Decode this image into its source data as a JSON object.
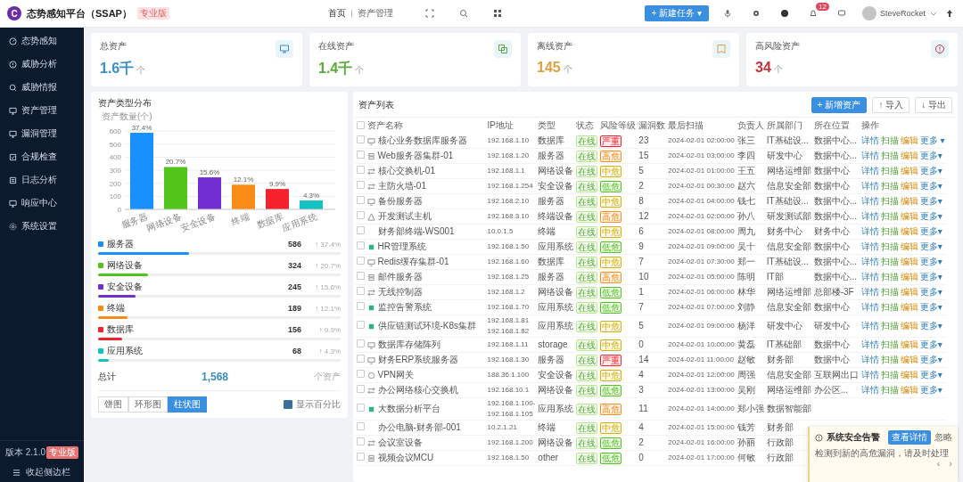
{
  "header": {
    "logo": "C",
    "title": "态势感知平台（SSAP）",
    "edition": "专业版",
    "breadcrumb": [
      "首页",
      "资产管理"
    ],
    "new_task": "+ 新建任务 ▾",
    "notify_count": "12",
    "user": "SteveRocket"
  },
  "sidebar": {
    "items": [
      {
        "label": "态势感知",
        "selected": false
      },
      {
        "label": "威胁分析",
        "selected": false
      },
      {
        "label": "威胁情报",
        "selected": false
      },
      {
        "label": "资产管理",
        "selected": false
      },
      {
        "label": "漏洞管理",
        "selected": false
      },
      {
        "label": "合规检查",
        "selected": false
      },
      {
        "label": "日志分析",
        "selected": false
      },
      {
        "label": "响应中心",
        "selected": false
      },
      {
        "label": "系统设置",
        "selected": false
      }
    ],
    "version": "版本 2.1.0",
    "version_badge": "专业版",
    "collapse": "收起侧边栏"
  },
  "stats": [
    {
      "label": "总资产",
      "value": "1.6千",
      "unit": "个",
      "color": "#3a8fc4"
    },
    {
      "label": "在线资产",
      "value": "1.4千",
      "unit": "个",
      "color": "#5bab3a"
    },
    {
      "label": "离线资产",
      "value": "145",
      "unit": "个",
      "color": "#e0a040"
    },
    {
      "label": "高风险资产",
      "value": "34",
      "unit": "个",
      "color": "#c8323c"
    }
  ],
  "distribution": {
    "title": "资产类型分布",
    "chart_data": {
      "type": "bar",
      "ylabel": "资产数量(个)",
      "categories": [
        "服务器",
        "网络设备",
        "安全设备",
        "终端",
        "数据库",
        "应用系统"
      ],
      "series": [
        {
          "values": [
            586,
            324,
            245,
            189,
            156,
            68
          ]
        }
      ],
      "ylim": [
        0,
        600
      ],
      "yticks": [
        0,
        100,
        200,
        300,
        400,
        500,
        600
      ],
      "grid": true,
      "value_labels": [
        "37.4%",
        "20.7%",
        "15.6%",
        "12.1%",
        "9.9%",
        "4.3%"
      ]
    },
    "items": [
      {
        "name": "服务器",
        "count": "586",
        "share": "↑ 37.4%",
        "level": 0.374,
        "color": "#1890ff"
      },
      {
        "name": "网络设备",
        "count": "324",
        "share": "↑ 20.7%",
        "level": 0.207,
        "color": "#52c41a"
      },
      {
        "name": "安全设备",
        "count": "245",
        "share": "↑ 15.6%",
        "level": 0.156,
        "color": "#722ed1"
      },
      {
        "name": "终端",
        "count": "189",
        "share": "↑ 12.1%",
        "level": 0.121,
        "color": "#fa8c16"
      },
      {
        "name": "数据库",
        "count": "156",
        "share": "↑ 9.9%",
        "level": 0.099,
        "color": "#f5222d"
      },
      {
        "name": "应用系统",
        "count": "68",
        "share": "↑ 4.3%",
        "level": 0.043,
        "color": "#13c2c2"
      }
    ],
    "total_label": "总计",
    "total": "1,568",
    "total_unit": "个资产",
    "views": [
      {
        "label": "饼图",
        "selected": false
      },
      {
        "label": "环形图",
        "selected": false
      },
      {
        "label": "柱状图",
        "selected": true
      }
    ],
    "show_percent": {
      "label": "显示百分比",
      "checked": true
    }
  },
  "assets": {
    "title": "资产列表",
    "actions": [
      "+ 新增资产",
      "↑ 导入",
      "↓ 导出"
    ],
    "select_all": false,
    "columns": [
      "资产名称",
      "IP地址",
      "类型",
      "状态",
      "风险等级",
      "漏洞数",
      "最后扫描",
      "负责人",
      "所属部门",
      "所在位置",
      "操作"
    ],
    "rows": [
      {
        "kind": "monitor",
        "checked": false,
        "name": "核心业务数据库服务器",
        "ip": [
          "192.168.1.10"
        ],
        "type": "数据库",
        "status": "在线",
        "risk": "严重",
        "color": "#f5222d",
        "vulns": "23",
        "scan": "2024-02-01 02:00:00",
        "owner": "张三",
        "dept": "IT基础设...",
        "location": "数据中心...",
        "ops": [
          "详情",
          "扫描",
          "编辑",
          "更多 ▾"
        ]
      },
      {
        "kind": "node",
        "checked": false,
        "name": "Web服务器集群-01",
        "ip": [
          "192.168.1.20"
        ],
        "type": "服务器",
        "status": "在线",
        "risk": "高危",
        "color": "#fa8c16",
        "vulns": "15",
        "scan": "2024-02-01 03:00:00",
        "owner": "李四",
        "dept": "研发中心",
        "location": "数据中心...",
        "ops": [
          "详情",
          "扫描",
          "编辑",
          "更多▾"
        ]
      },
      {
        "kind": "switch",
        "checked": false,
        "name": "核心交换机-01",
        "ip": [
          "192.168.1.1"
        ],
        "type": "网络设备",
        "status": "在线",
        "risk": "中危",
        "color": "#d4b106",
        "vulns": "5",
        "scan": "2024-02-01 01:00:00",
        "owner": "王五",
        "dept": "网络运维部",
        "location": "数据中心",
        "ops": [
          "详情",
          "扫描",
          "编辑",
          "更多▾"
        ]
      },
      {
        "kind": "switch",
        "checked": false,
        "name": "主防火墙-01",
        "ip": [
          "192.168.1.254"
        ],
        "type": "安全设备",
        "status": "在线",
        "risk": "低危",
        "color": "#52c41a",
        "vulns": "2",
        "scan": "2024-02-01 00:30:00",
        "owner": "赵六",
        "dept": "信息安全部",
        "location": "数据中心",
        "ops": [
          "详情",
          "扫描",
          "编辑",
          "更多▾"
        ]
      },
      {
        "kind": "monitor",
        "checked": false,
        "name": "备份服务器",
        "ip": [
          "192.168.2.10"
        ],
        "type": "服务器",
        "status": "在线",
        "risk": "中危",
        "color": "#d4b106",
        "vulns": "8",
        "scan": "2024-02-01 04:00:00",
        "owner": "钱七",
        "dept": "IT基础设...",
        "location": "数据中心...",
        "ops": [
          "详情",
          "扫描",
          "编辑",
          "更多▾"
        ]
      },
      {
        "kind": "warn",
        "checked": false,
        "name": "开发测试主机",
        "ip": [
          "192.168.3.10"
        ],
        "type": "终端设备",
        "status": "在线",
        "risk": "高危",
        "color": "#fa8c16",
        "vulns": "12",
        "scan": "2024-02-01 02:00:00",
        "owner": "孙八",
        "dept": "研发测试部",
        "location": "数据中心...",
        "ops": [
          "详情",
          "扫描",
          "编辑",
          "更多▾"
        ]
      },
      {
        "kind": "plain",
        "checked": false,
        "name": "财务部终端-WS001",
        "ip": [
          "10.0.1.5"
        ],
        "type": "终端",
        "status": "在线",
        "risk": "中危",
        "color": "#d4b106",
        "vulns": "6",
        "scan": "2024-02-01 08:00:00",
        "owner": "周九",
        "dept": "财务中心",
        "location": "财务中心",
        "ops": [
          "详情",
          "扫描",
          "编辑",
          "更多▾"
        ]
      },
      {
        "kind": "app",
        "checked": false,
        "name": "HR管理系统",
        "ip": [
          "192.168.1.50"
        ],
        "type": "应用系统",
        "status": "在线",
        "risk": "低危",
        "color": "#52c41a",
        "vulns": "9",
        "scan": "2024-02-01 09:00:00",
        "owner": "吴十",
        "dept": "信息安全部",
        "location": "数据中心",
        "ops": [
          "详情",
          "扫描",
          "编辑",
          "更多▾"
        ]
      },
      {
        "kind": "monitor",
        "checked": false,
        "name": "Redis缓存集群-01",
        "ip": [
          "192.168.1.60"
        ],
        "type": "数据库",
        "status": "在线",
        "risk": "中危",
        "color": "#d4b106",
        "vulns": "7",
        "scan": "2024-02-01 07:30:00",
        "owner": "郑一",
        "dept": "IT基础设...",
        "location": "数据中心...",
        "ops": [
          "详情",
          "扫描",
          "编辑",
          "更多▾"
        ]
      },
      {
        "kind": "node",
        "checked": false,
        "name": "邮件服务器",
        "ip": [
          "192.168.1.25"
        ],
        "type": "服务器",
        "status": "在线",
        "risk": "高危",
        "color": "#fa8c16",
        "vulns": "10",
        "scan": "2024-02-01 05:00:00",
        "owner": "陈明",
        "dept": "IT部",
        "location": "数据中心...",
        "ops": [
          "详情",
          "扫描",
          "编辑",
          "更多▾"
        ]
      },
      {
        "kind": "switch",
        "checked": false,
        "name": "无线控制器",
        "ip": [
          "192.168.1.2"
        ],
        "type": "网络设备",
        "status": "在线",
        "risk": "低危",
        "color": "#52c41a",
        "vulns": "1",
        "scan": "2024-02-01 06:00:00",
        "owner": "林华",
        "dept": "网络运维部",
        "location": "总部楼-3F",
        "ops": [
          "详情",
          "扫描",
          "编辑",
          "更多▾"
        ]
      },
      {
        "kind": "app",
        "checked": false,
        "name": "监控告警系统",
        "ip": [
          "192.168.1.70"
        ],
        "type": "应用系统",
        "status": "在线",
        "risk": "低危",
        "color": "#52c41a",
        "vulns": "7",
        "scan": "2024-02-01 07:00:00",
        "owner": "刘静",
        "dept": "信息安全部",
        "location": "数据中心",
        "ops": [
          "详情",
          "扫描",
          "编辑",
          "更多▾"
        ]
      },
      {
        "kind": "app",
        "checked": false,
        "name": "供应链测试环境-K8s集群",
        "ip": [
          "192.168.1.81",
          "192.168.1.82"
        ],
        "type": "应用系统",
        "status": "在线",
        "risk": "中危",
        "color": "#d4b106",
        "vulns": "5",
        "scan": "2024-02-01 09:00:00",
        "owner": "杨洋",
        "dept": "研发中心",
        "location": "研发中心",
        "ops": [
          "详情",
          "扫描",
          "编辑",
          "更多▾"
        ]
      },
      {
        "kind": "monitor",
        "checked": false,
        "name": "数据库存储阵列",
        "ip": [
          "192.168.1.11"
        ],
        "type": "storage",
        "status": "在线",
        "risk": "中危",
        "color": "#d4b106",
        "vulns": "0",
        "scan": "2024-02-01 10:00:00",
        "owner": "黄磊",
        "dept": "IT基础部",
        "location": "数据中心",
        "ops": [
          "详情",
          "扫描",
          "编辑",
          "更多▾"
        ]
      },
      {
        "kind": "monitor",
        "checked": false,
        "name": "财务ERP系统服务器",
        "ip": [
          "192.168.1.30"
        ],
        "type": "服务器",
        "status": "在线",
        "risk": "严重",
        "color": "#f5222d",
        "vulns": "14",
        "scan": "2024-02-01 11:00:00",
        "owner": "赵敏",
        "dept": "财务部",
        "location": "数据中心",
        "ops": [
          "详情",
          "扫描",
          "编辑",
          "更多▾"
        ]
      },
      {
        "kind": "globe",
        "checked": false,
        "name": "VPN网关",
        "ip": [
          "188.36.1.100"
        ],
        "type": "安全设备",
        "status": "在线",
        "risk": "中危",
        "color": "#d4b106",
        "vulns": "4",
        "scan": "2024-02-01 12:00:00",
        "owner": "周强",
        "dept": "信息安全部",
        "location": "互联网出口",
        "ops": [
          "详情",
          "扫描",
          "编辑",
          "更多▾"
        ]
      },
      {
        "kind": "switch",
        "checked": false,
        "name": "办公网络核心交换机",
        "ip": [
          "192.168.10.1"
        ],
        "type": "网络设备",
        "status": "在线",
        "risk": "低危",
        "color": "#52c41a",
        "vulns": "3",
        "scan": "2024-02-01 13:00:00",
        "owner": "吴刚",
        "dept": "网络运维部",
        "location": "办公区...",
        "ops": [
          "详情",
          "扫描",
          "编辑",
          "更多▾"
        ]
      },
      {
        "kind": "app",
        "checked": false,
        "name": "大数据分析平台",
        "ip": [
          "192.168.1.100-",
          "192.168.1.105"
        ],
        "type": "应用系统",
        "status": "在线",
        "risk": "高危",
        "color": "#fa8c16",
        "vulns": "11",
        "scan": "2024-02-01 14:00:00",
        "owner": "郑小强",
        "dept": "数据智能部"
      },
      {
        "kind": "plain",
        "checked": false,
        "name": "办公电脑-财务部-001",
        "ip": [
          "10.2.1.21"
        ],
        "type": "终端",
        "status": "在线",
        "risk": "中危",
        "color": "#d4b106",
        "vulns": "4",
        "scan": "2024-02-01 15:00:00",
        "owner": "钱芳",
        "dept": "财务部"
      },
      {
        "kind": "switch",
        "checked": false,
        "name": "会议室设备",
        "ip": [
          "192.168.1.200"
        ],
        "type": "网络设备",
        "status": "在线",
        "risk": "低危",
        "color": "#52c41a",
        "vulns": "2",
        "scan": "2024-02-01 16:00:00",
        "owner": "孙丽",
        "dept": "行政部"
      },
      {
        "kind": "node",
        "checked": false,
        "name": "视频会议MCU",
        "ip": [
          "192.168.1.50"
        ],
        "type": "other",
        "status": "在线",
        "risk": "低危",
        "color": "#52c41a",
        "vulns": "0",
        "scan": "2024-02-01 17:00:00",
        "owner": "何敏",
        "dept": "行政部"
      }
    ]
  },
  "alert": {
    "title": "系统安全告警",
    "action": "查看详情",
    "dismiss": "忽略",
    "body": "检测到新的高危漏洞，请及时处理",
    "prev": "‹",
    "next": "›"
  }
}
